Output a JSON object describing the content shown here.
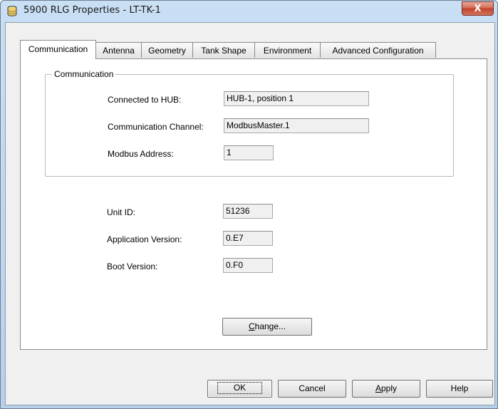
{
  "window": {
    "title": "5900 RLG Properties - LT-TK-1",
    "close_symbol": "X",
    "accent": "#b9d2eb",
    "close_color": "#c94a33"
  },
  "tabs": [
    {
      "label": "Communication",
      "active": true
    },
    {
      "label": "Antenna",
      "active": false
    },
    {
      "label": "Geometry",
      "active": false
    },
    {
      "label": "Tank Shape",
      "active": false
    },
    {
      "label": "Environment",
      "active": false
    },
    {
      "label": "Advanced Configuration",
      "active": false
    }
  ],
  "communication_group": {
    "title": "Communication",
    "connected_to_hub": {
      "label": "Connected to HUB:",
      "value": "HUB-1, position 1"
    },
    "communication_channel": {
      "label": "Communication Channel:",
      "value": "ModbusMaster.1"
    },
    "modbus_address": {
      "label": "Modbus Address:",
      "value": "1"
    }
  },
  "info": {
    "unit_id": {
      "label": "Unit ID:",
      "value": "51236"
    },
    "application_version": {
      "label": "Application Version:",
      "value": "0.E7"
    },
    "boot_version": {
      "label": "Boot Version:",
      "value": "0.F0"
    }
  },
  "change_button": {
    "mnemonic": "C",
    "rest": "hange..."
  },
  "footer": {
    "ok": "OK",
    "cancel": "Cancel",
    "apply_mnemonic": "A",
    "apply_rest": "pply",
    "help": "Help"
  },
  "icons": {
    "app": "database-icon",
    "close": "close-icon"
  }
}
